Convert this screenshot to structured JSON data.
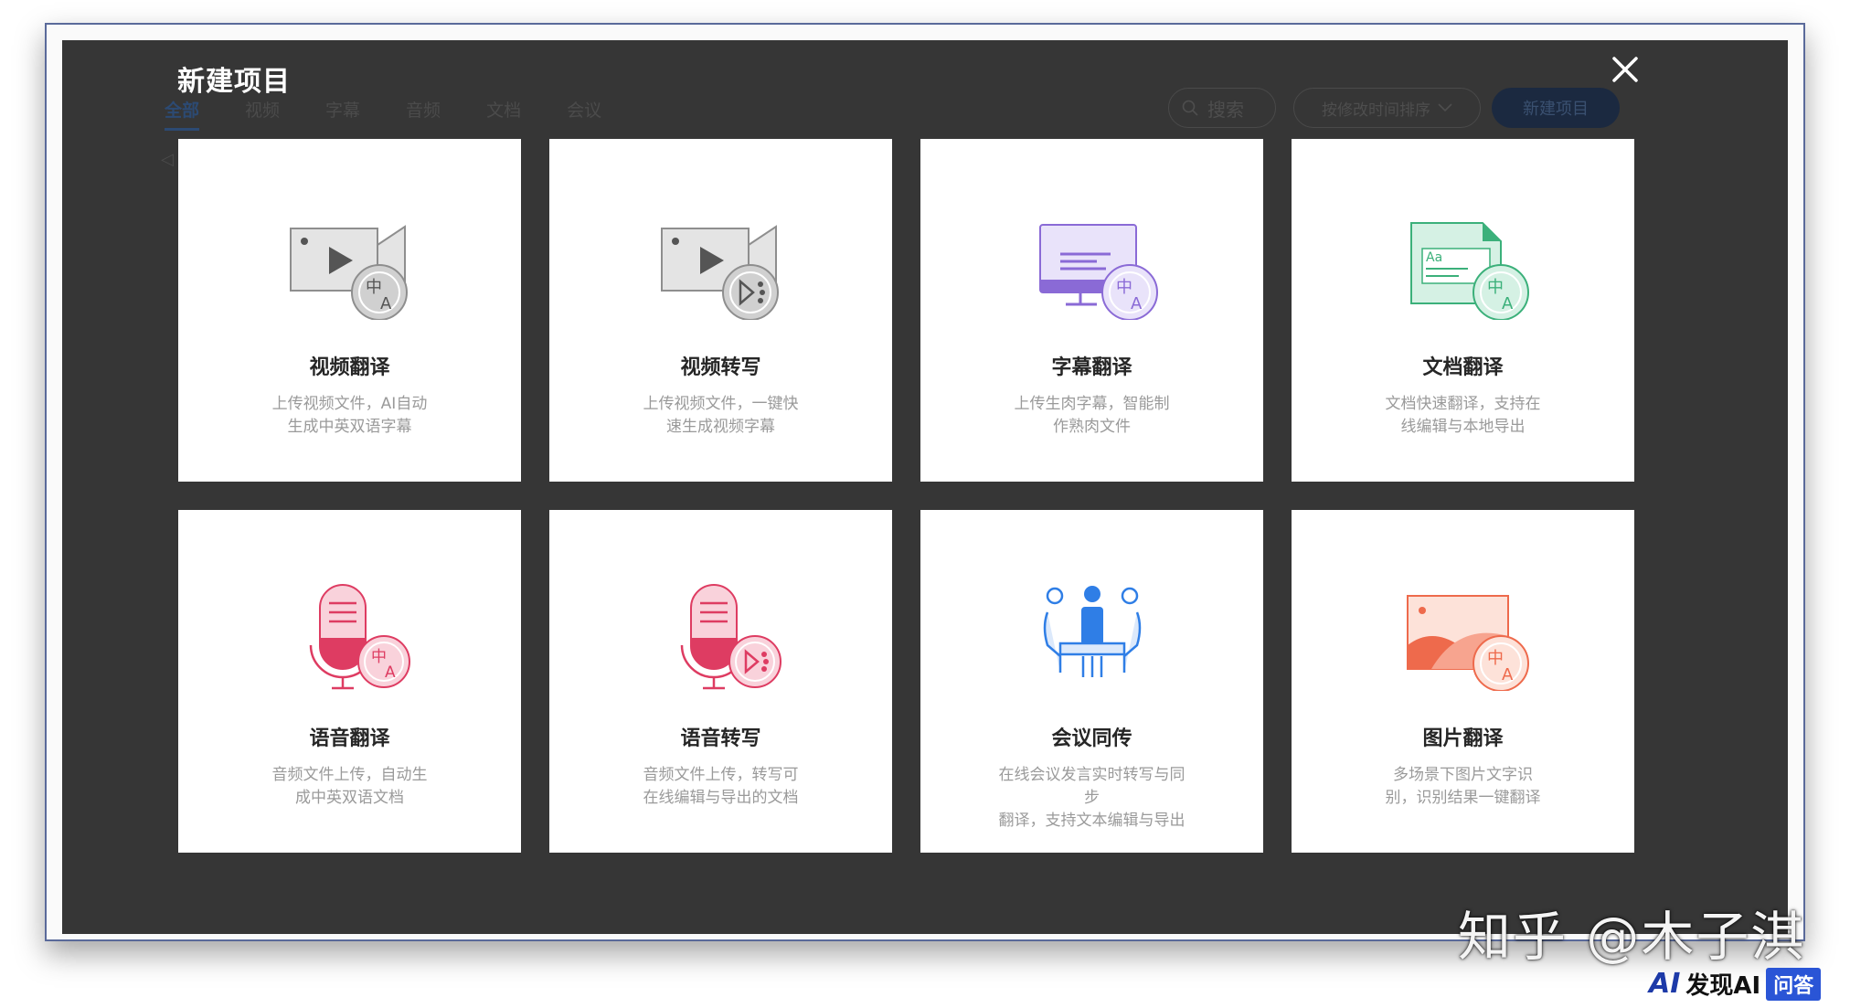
{
  "dialog": {
    "title": "新建项目",
    "close_icon": "close-icon"
  },
  "background": {
    "tabs": [
      "全部",
      "视频",
      "字幕",
      "音频",
      "文档",
      "会议"
    ],
    "search_placeholder": "搜索",
    "sort_label": "按修改时间排序",
    "new_button": "新建项目"
  },
  "cards": [
    {
      "title": "视频翻译",
      "line1": "上传视频文件，AI自动",
      "line2": "生成中英双语字幕",
      "icon": "video-translate-icon"
    },
    {
      "title": "视频转写",
      "line1": "上传视频文件，一键快",
      "line2": "速生成视频字幕",
      "icon": "video-transcribe-icon"
    },
    {
      "title": "字幕翻译",
      "line1": "上传生肉字幕，智能制",
      "line2": "作熟肉文件",
      "icon": "subtitle-translate-icon"
    },
    {
      "title": "文档翻译",
      "line1": "文档快速翻译，支持在",
      "line2": "线编辑与本地导出",
      "icon": "document-translate-icon"
    },
    {
      "title": "语音翻译",
      "line1": "音频文件上传，自动生",
      "line2": "成中英双语文档",
      "icon": "audio-translate-icon"
    },
    {
      "title": "语音转写",
      "line1": "音频文件上传，转写可",
      "line2": "在线编辑与导出的文档",
      "icon": "audio-transcribe-icon"
    },
    {
      "title": "会议同传",
      "line1": "在线会议发言实时转写与同步",
      "line2": "翻译，支持文本编辑与导出",
      "icon": "meeting-interpret-icon"
    },
    {
      "title": "图片翻译",
      "line1": "多场景下图片文字识",
      "line2": "别，识别结果一键翻译",
      "icon": "image-translate-icon"
    }
  ],
  "watermark": "知乎 @木子淇",
  "site_logo": {
    "mark": "AI",
    "name": "发现AI",
    "badge": "问答"
  }
}
